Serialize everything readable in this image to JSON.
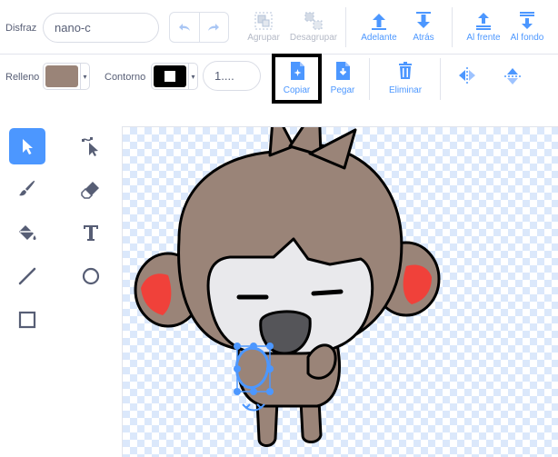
{
  "costume": {
    "label": "Disfraz",
    "name_value": "nano-c"
  },
  "toolbar": {
    "group": "Agrupar",
    "ungroup": "Desagrupar",
    "forward": "Adelante",
    "backward": "Atrás",
    "front": "Al frente",
    "back": "Al fondo",
    "copy": "Copiar",
    "paste": "Pegar",
    "delete": "Eliminar"
  },
  "fill": {
    "label": "Relleno",
    "color": "#9a8478"
  },
  "outline": {
    "label": "Contorno",
    "color": "#000000",
    "width_value": "1...."
  },
  "tools": [
    {
      "name": "select",
      "icon": "arrow-select-icon",
      "active": true
    },
    {
      "name": "reshape",
      "icon": "reshape-icon",
      "active": false
    },
    {
      "name": "brush",
      "icon": "brush-icon",
      "active": false
    },
    {
      "name": "eraser",
      "icon": "eraser-icon",
      "active": false
    },
    {
      "name": "fill",
      "icon": "fill-bucket-icon",
      "active": false
    },
    {
      "name": "text",
      "icon": "text-icon",
      "active": false
    },
    {
      "name": "line",
      "icon": "line-icon",
      "active": false
    },
    {
      "name": "circle",
      "icon": "circle-icon",
      "active": false
    },
    {
      "name": "rectangle",
      "icon": "rectangle-icon",
      "active": false
    }
  ],
  "colors": {
    "accent": "#4c97ff",
    "text": "#575e75",
    "ear_inner": "#f0413a",
    "fur": "#9a8478",
    "face": "#e9e9ec"
  }
}
